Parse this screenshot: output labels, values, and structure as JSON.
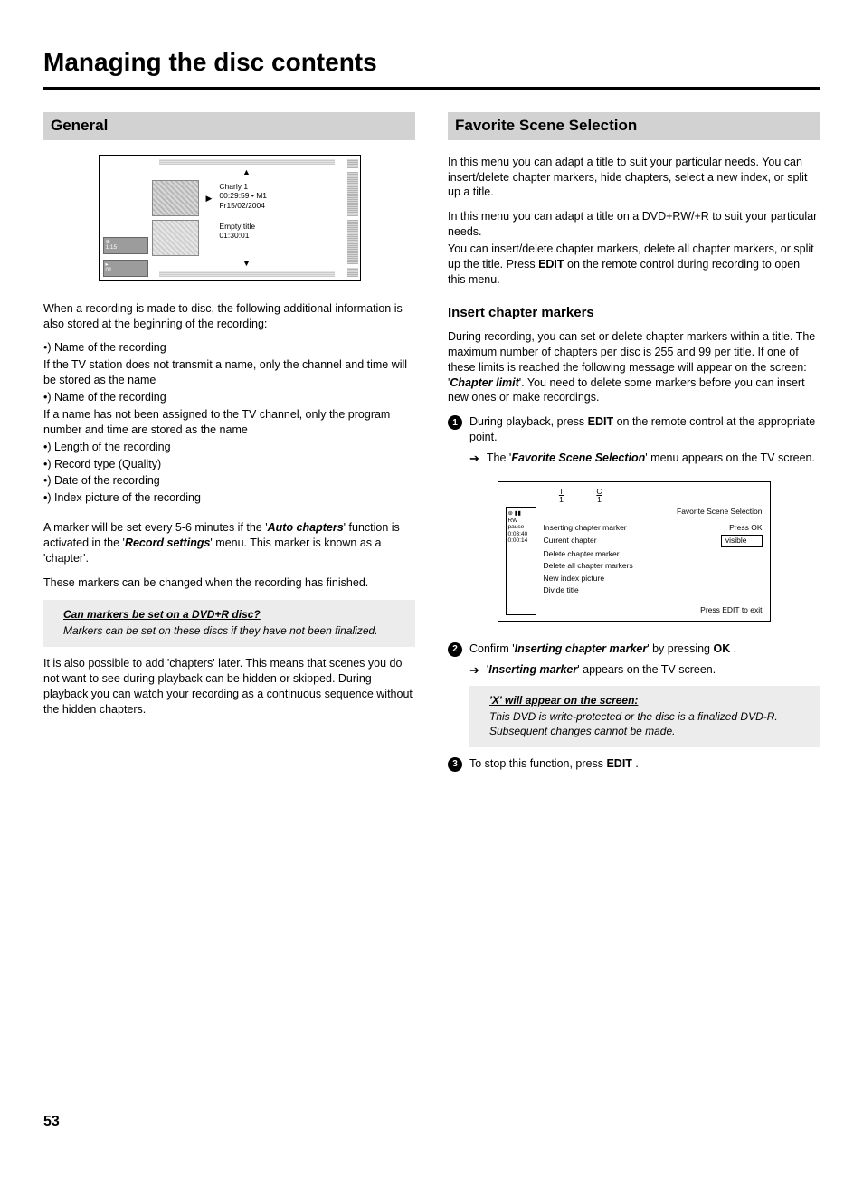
{
  "page": {
    "title": "Managing the disc contents",
    "number": "53"
  },
  "general": {
    "heading": "General",
    "tv": {
      "row1": {
        "title": "Charly 1",
        "time": "00:29:59 • M1",
        "date": "Fr15/02/2004"
      },
      "row2": {
        "title": "Empty title",
        "time": "01:30:01"
      },
      "timecode1_a": "⊕",
      "timecode1_b": "1:15",
      "timecode2_a": "▸",
      "timecode2_b": "01"
    },
    "intro1": "When a recording is made to disc, the following additional information is also stored at the beginning of the recording:",
    "b1": "•) Name of the recording",
    "cond1": "If the TV station does not transmit a name, only the channel and time will be stored as the name",
    "b2": "•) Name of the recording",
    "cond2": "If a name has not been assigned to the TV channel, only the program number and time are stored as the name",
    "b3": "•) Length of the recording",
    "b4": "•) Record type (Quality)",
    "b5": "•) Date of the recording",
    "b6": "•) Index picture of the recording",
    "marker_p1a": "A marker will be set every 5-6 minutes if the '",
    "marker_p1_bold1": "Auto chapters",
    "marker_p1b": "' function is activated in the '",
    "marker_p1_bold2": "Record settings",
    "marker_p1c": "' menu. This marker is known as a 'chapter'.",
    "marker_p2": "These markers can be changed when the recording has finished.",
    "note": {
      "title": "Can markers be set on a DVD+R disc?",
      "body": "Markers can be set on these discs if they have not been finalized."
    },
    "after_note": "It is also possible to add 'chapters' later. This means that scenes you do not want to see during playback can be hidden or skipped. During playback you can watch your recording as a continuous sequence without the hidden chapters."
  },
  "favorite": {
    "heading": "Favorite Scene Selection",
    "p1": "In this menu you can adapt a title to suit your particular needs. You can insert/delete chapter markers, hide chapters, select a new index, or split up a title.",
    "p2a": "In this menu you can adapt a title on a DVD+RW/+R to suit your particular needs.",
    "p2b_pre": "You can insert/delete chapter markers, delete all chapter markers, or split up the title. Press ",
    "p2b_edit": "EDIT",
    "p2b_post": " on the remote control during recording to open this menu.",
    "sub": "Insert chapter markers",
    "sub_p_pre": "During recording, you can set or delete chapter markers within a title. The maximum number of chapters per disc is 255 and 99 per title. If one of these limits is reached the following message will appear on the screen: '",
    "sub_p_bold": "Chapter limit",
    "sub_p_post": "'. You need to delete some markers before you can insert new ones or make recordings.",
    "step1_pre": "During playback, press ",
    "step1_edit": "EDIT",
    "step1_post": " on the remote control at the appropriate point.",
    "step1_arrow_pre": "The '",
    "step1_arrow_bold": "Favorite Scene Selection",
    "step1_arrow_post": "' menu appears on the TV screen.",
    "tv2": {
      "T": "T",
      "C": "C",
      "one": "1",
      "left": {
        "l1": "⊛  ▮▮",
        "l2": "RW pause",
        "l3": "0:03:40",
        "l4": "0:00:14"
      },
      "title": "Favorite Scene Selection",
      "rows": {
        "r1l": "Inserting chapter marker",
        "r1r": "Press OK",
        "r2l": "Current chapter",
        "r2r": "visible",
        "r3l": "Delete chapter marker",
        "r4l": "Delete all chapter markers",
        "r5l": "New index picture",
        "r6l": "Divide title"
      },
      "footer": "Press EDIT to exit"
    },
    "step2_pre": "Confirm '",
    "step2_bold": "Inserting chapter marker",
    "step2_mid": "' by pressing ",
    "step2_ok": "OK",
    "step2_post": " .",
    "step2_arrow_pre": "'",
    "step2_arrow_bold": "Inserting marker",
    "step2_arrow_post": "' appears on the TV screen.",
    "note2": {
      "title": "'X' will appear on the screen:",
      "body": "This DVD is write-protected or the disc is a finalized DVD-R. Subsequent changes cannot be made."
    },
    "step3_pre": "To stop this function, press ",
    "step3_edit": "EDIT",
    "step3_post": " ."
  }
}
